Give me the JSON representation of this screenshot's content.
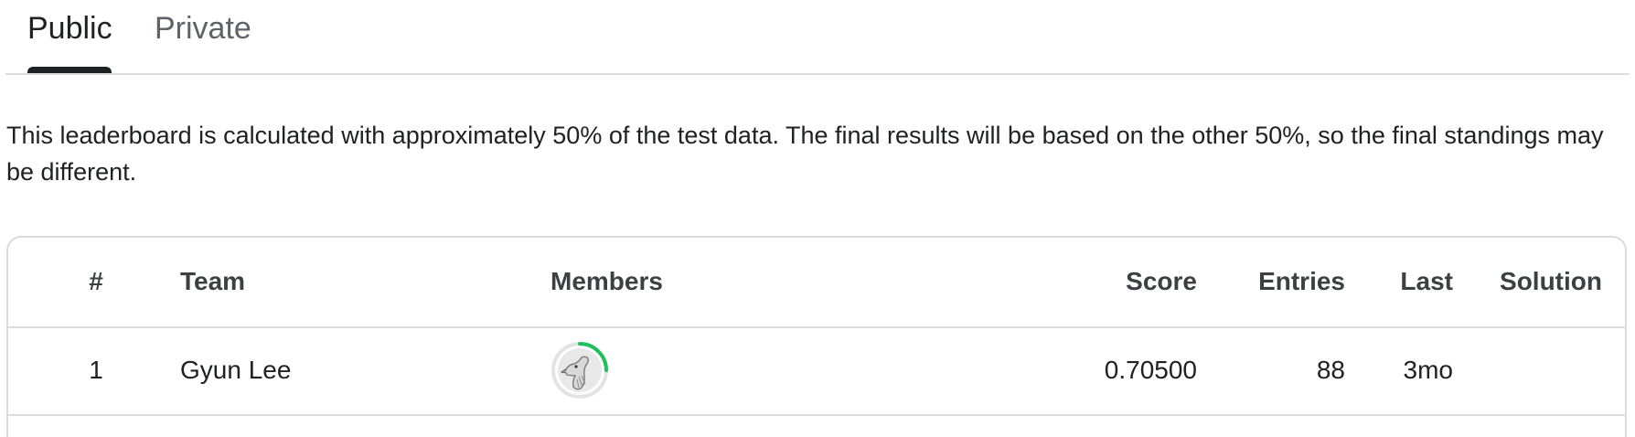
{
  "tabs": [
    {
      "label": "Public",
      "selected": true
    },
    {
      "label": "Private",
      "selected": false
    }
  ],
  "note": "This leaderboard is calculated with approximately 50% of the test data. The final results will be based on the other 50%, so the final standings may be different.",
  "leaderboard": {
    "columns": {
      "rank": "#",
      "team": "Team",
      "members": "Members",
      "score": "Score",
      "entries": "Entries",
      "last": "Last",
      "solution": "Solution"
    },
    "rows": [
      {
        "rank": "1",
        "team": "Gyun Lee",
        "member_avatar_icon": "goose-avatar-icon",
        "score": "0.70500",
        "entries": "88",
        "last": "3mo",
        "solution": ""
      }
    ]
  },
  "colors": {
    "accent_ring": "#20BE5C",
    "border": "#DADCE0",
    "text": "#202124",
    "muted_text": "#5F6368"
  }
}
